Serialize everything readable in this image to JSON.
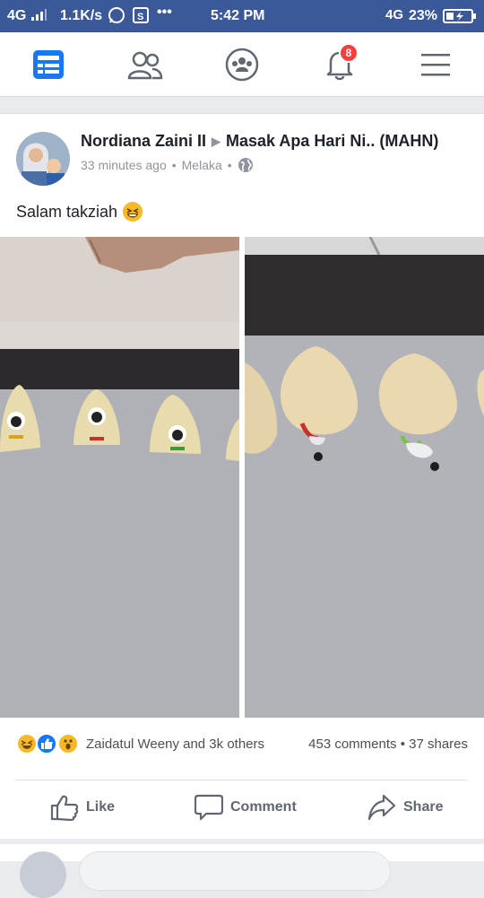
{
  "statusbar": {
    "network": "4G",
    "speed": "1.1K/s",
    "time": "5:42 PM",
    "network_right": "4G",
    "battery": "23%"
  },
  "nav": {
    "notification_count": "8"
  },
  "post": {
    "author": "Nordiana Zaini II",
    "group": "Masak Apa Hari Ni.. (MAHN)",
    "time": "33 minutes ago",
    "location": "Melaka",
    "text": "Salam takziah",
    "reaction_names": "Zaidatul Weeny and 3k others",
    "comments": "453 comments",
    "shares": "37 shares",
    "actions": {
      "like": "Like",
      "comment": "Comment",
      "share": "Share"
    }
  },
  "colors": {
    "brand": "#3b5998",
    "badge": "#fa3e3e",
    "like_blue": "#1877f2"
  }
}
